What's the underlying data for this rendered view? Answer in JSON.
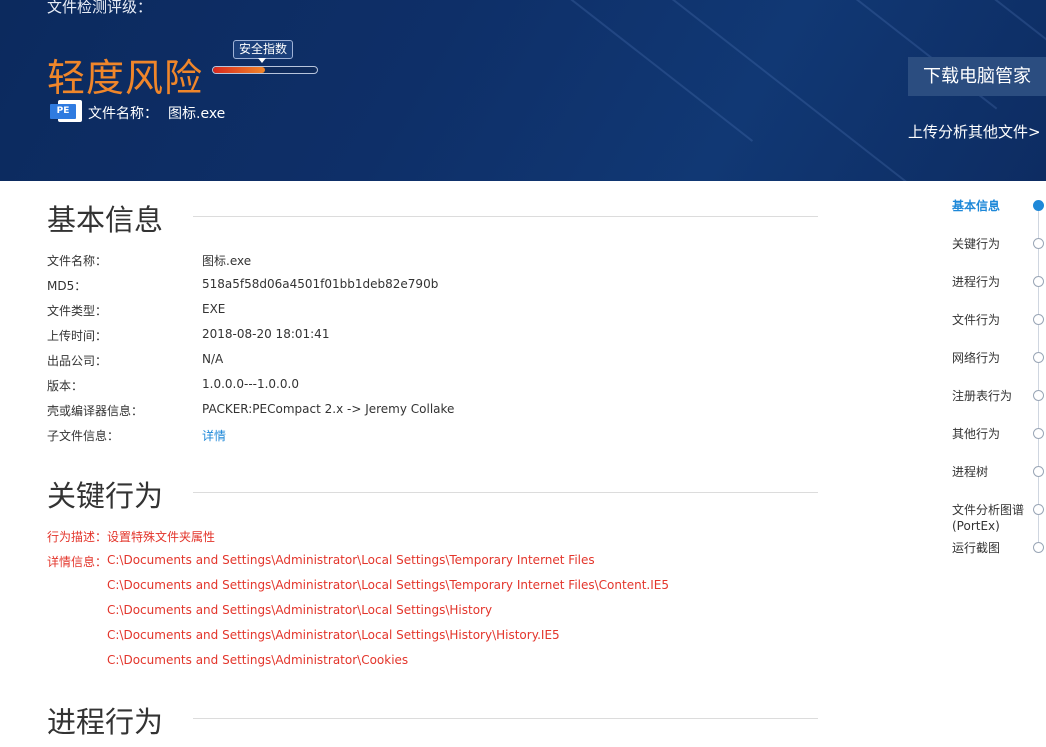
{
  "header": {
    "grade_label": "文件检测评级：",
    "risk_level": "轻度风险",
    "index_tag": "安全指数",
    "risk_meter_fill_pct": 50,
    "file_icon_text": "PE",
    "file_name_label": "文件名称：",
    "file_name_value": "图标.exe",
    "download_button": "下载电脑管家",
    "upload_link": "上传分析其他文件>"
  },
  "basic_info": {
    "title": "基本信息",
    "rows": [
      {
        "label": "文件名称：",
        "value": "图标.exe"
      },
      {
        "label": "MD5：",
        "value": "518a5f58d06a4501f01bb1deb82e790b"
      },
      {
        "label": "文件类型：",
        "value": "EXE"
      },
      {
        "label": "上传时间：",
        "value": "2018-08-20 18:01:41"
      },
      {
        "label": "出品公司：",
        "value": "N/A"
      },
      {
        "label": "版本：",
        "value": "1.0.0.0---1.0.0.0"
      },
      {
        "label": "壳或编译器信息：",
        "value": "PACKER:PECompact 2.x -> Jeremy Collake"
      },
      {
        "label": "子文件信息：",
        "value": "详情"
      }
    ]
  },
  "key_behavior": {
    "title": "关键行为",
    "desc_label": "行为描述：",
    "desc_value": "设置特殊文件夹属性",
    "detail_label": "详情信息：",
    "details": [
      "C:\\Documents and Settings\\Administrator\\Local Settings\\Temporary Internet Files",
      "C:\\Documents and Settings\\Administrator\\Local Settings\\Temporary Internet Files\\Content.IE5",
      "C:\\Documents and Settings\\Administrator\\Local Settings\\History",
      "C:\\Documents and Settings\\Administrator\\Local Settings\\History\\History.IE5",
      "C:\\Documents and Settings\\Administrator\\Cookies"
    ]
  },
  "process_behavior": {
    "title": "进程行为"
  },
  "side_nav": {
    "items": [
      {
        "label": "基本信息"
      },
      {
        "label": "关键行为"
      },
      {
        "label": "进程行为"
      },
      {
        "label": "文件行为"
      },
      {
        "label": "网络行为"
      },
      {
        "label": "注册表行为"
      },
      {
        "label": "其他行为"
      },
      {
        "label": "进程树"
      },
      {
        "label": "文件分析图谱",
        "sub": "(PortEx)"
      },
      {
        "label": "运行截图"
      }
    ]
  },
  "colors": {
    "banner": "#0e2f68",
    "risk_orange": "#f0862a",
    "accent_blue": "#1e88d8",
    "alert_red": "#e3352b"
  }
}
